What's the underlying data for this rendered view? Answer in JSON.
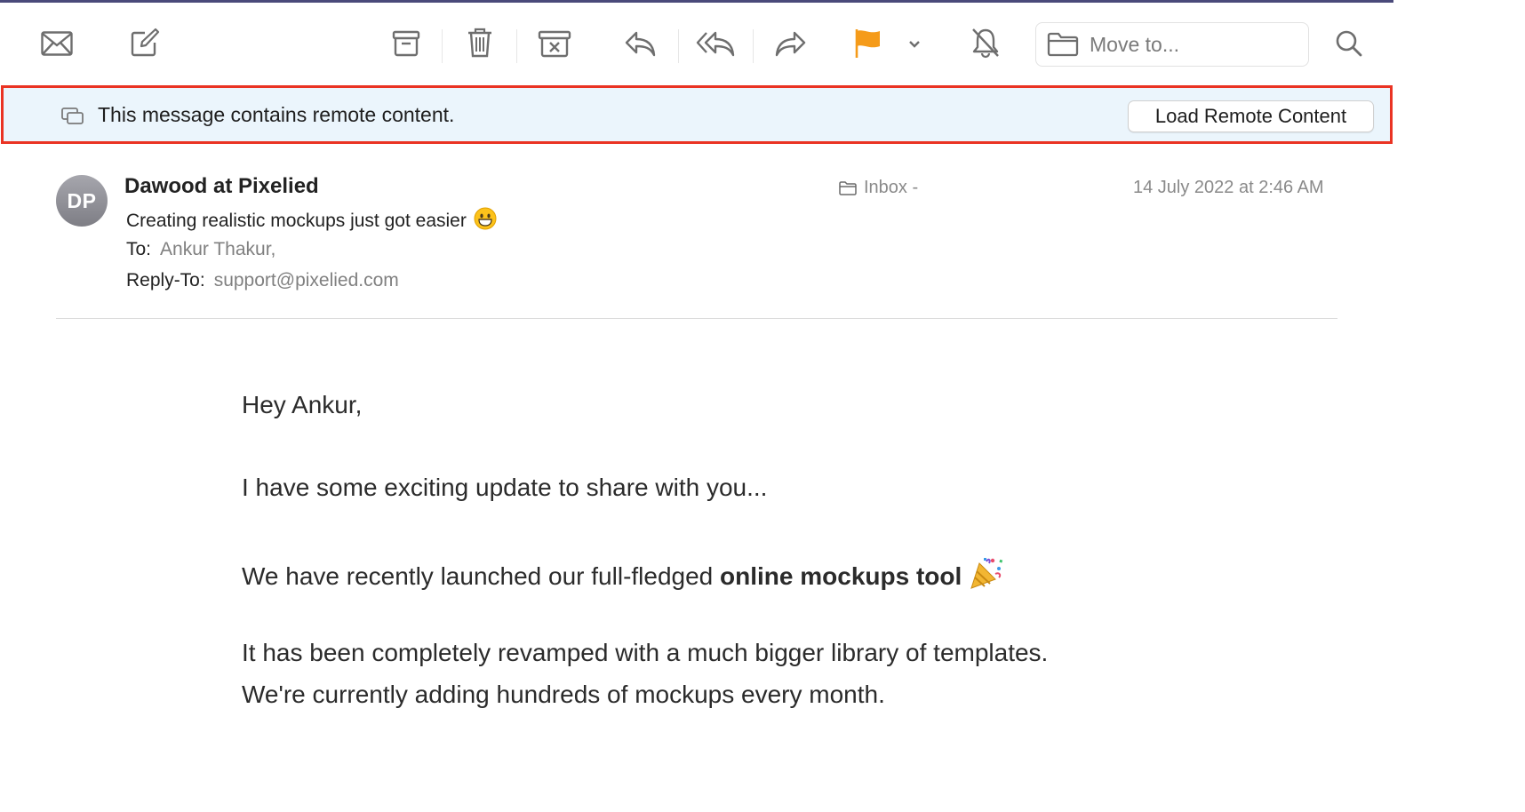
{
  "toolbar": {
    "move_to_label": "Move to...",
    "flag_color": "#f59b1a",
    "icons": [
      "mail-icon",
      "compose-icon",
      "archive-icon",
      "trash-icon",
      "junk-icon",
      "reply-icon",
      "reply-all-icon",
      "forward-icon",
      "flag-icon",
      "chevron-down-icon",
      "mute-bell-icon",
      "folder-icon",
      "search-icon"
    ]
  },
  "banner": {
    "message": "This message contains remote content.",
    "button_label": "Load Remote Content",
    "highlight_color": "#ea3323",
    "background": "#ebf5fc"
  },
  "header": {
    "avatar_initials": "DP",
    "sender": "Dawood at Pixelied",
    "subject": "Creating realistic mockups just got easier",
    "to_label": "To:",
    "to_value": "Ankur Thakur,",
    "reply_to_label": "Reply-To:",
    "reply_to_value": "support@pixelied.com",
    "mailbox": "Inbox -",
    "date": "14 July 2022 at 2:46 AM"
  },
  "body": {
    "greeting": "Hey Ankur,",
    "line1": "I have some exciting update to share with you...",
    "line2_prefix": "We have recently launched our full-fledged ",
    "line2_bold": "online mockups tool",
    "line3": "It has been completely revamped with a much bigger library of templates.",
    "line4": "We're currently adding hundreds of mockups every month."
  }
}
